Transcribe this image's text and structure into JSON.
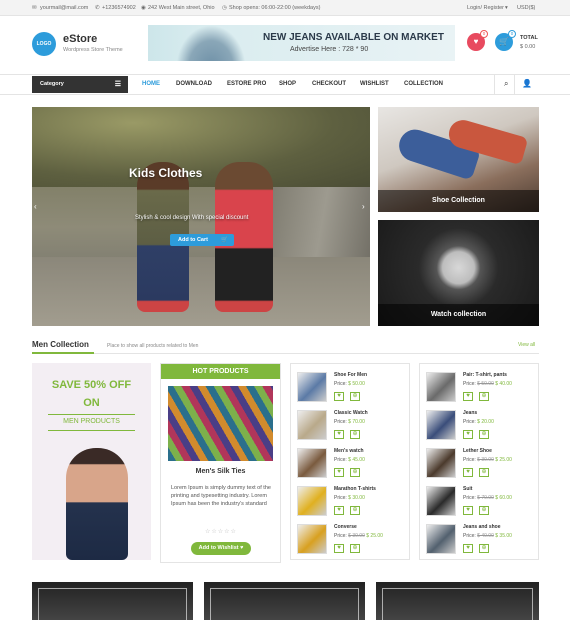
{
  "topbar": {
    "email": "yourmail@mail.com",
    "phone": "+1236574902",
    "address": "242 West Main street, Ohio",
    "hours": "Shop opens: 06:00-22:00 (weekdays)",
    "login": "Login/ Register",
    "currency": "USD($)"
  },
  "header": {
    "logo_text": "LOGO",
    "brand": "eStore",
    "tagline": "Wordpress Store Theme",
    "banner_title": "NEW JEANS AVAILABLE ON MARKET",
    "banner_sub": "Advertise Here : 728 * 90",
    "wishlist_count": "0",
    "cart_count": "0",
    "total_label": "TOTAL",
    "total_value": "$ 0.00"
  },
  "nav": {
    "category": "Category",
    "items": [
      "HOME",
      "DOWNLOAD",
      "ESTORE PRO",
      "SHOP",
      "CHECKOUT",
      "WISHLIST",
      "COLLECTION"
    ]
  },
  "slider": {
    "title": "Kids Clothes",
    "subtitle": "Stylish & cool design With special discount",
    "button": "Add to Cart"
  },
  "tiles": {
    "shoes": "Shoe Collection",
    "watch": "Watch collection"
  },
  "section": {
    "title": "Men Collection",
    "desc": "Place to show all products related to Men",
    "view_all": "View all"
  },
  "promo": {
    "line1": "SAVE 50% OFF",
    "line2": "ON",
    "line3": "MEN PRODUCTS"
  },
  "hot": {
    "header": "HOT PRODUCTS",
    "name": "Men's Silk Ties",
    "desc": "Lorem Ipsum is simply dummy text of the printing and typesetting industry. Lorem Ipsum has been the industry's standard",
    "stars": "☆☆☆☆☆",
    "button": "Add to Wishlist"
  },
  "list1": [
    {
      "name": "Shoe For Men",
      "label": "Price:",
      "old": "",
      "price": "$ 50.00",
      "img": "#5b7aa6"
    },
    {
      "name": "Classic Watch",
      "label": "Price:",
      "old": "",
      "price": "$ 70.00",
      "img": "#b9a98a"
    },
    {
      "name": "Men's watch",
      "label": "Price:",
      "old": "",
      "price": "$ 45.00",
      "img": "#7a5a3e"
    },
    {
      "name": "Marathon T-shirts",
      "label": "Price:",
      "old": "",
      "price": "$ 30.00",
      "img": "#e0b020"
    },
    {
      "name": "Converse",
      "label": "Price:",
      "old": "$ 30.00",
      "price": "$ 25.00",
      "img": "#d8a020"
    }
  ],
  "list2": [
    {
      "name": "Pair: T-shirt, pants",
      "label": "Price:",
      "old": "$ 50.00",
      "price": "$ 40.00",
      "img": "#6a6a6a"
    },
    {
      "name": "Jeans",
      "label": "Price:",
      "old": "",
      "price": "$ 20.00",
      "img": "#3a4d7a"
    },
    {
      "name": "Lether Shoe",
      "label": "Price:",
      "old": "$ 30.00",
      "price": "$ 25.00",
      "img": "#4b3a2c"
    },
    {
      "name": "Suit",
      "label": "Price:",
      "old": "$ 70.00",
      "price": "$ 60.00",
      "img": "#2a2a2a"
    },
    {
      "name": "Jeans and shoe",
      "label": "Price:",
      "old": "$ 40.00",
      "price": "$ 35.00",
      "img": "#52606e"
    }
  ],
  "colors": {
    "accent_blue": "#2d9cdb",
    "accent_green": "#80b83c",
    "heart_red": "#e84a5f"
  }
}
